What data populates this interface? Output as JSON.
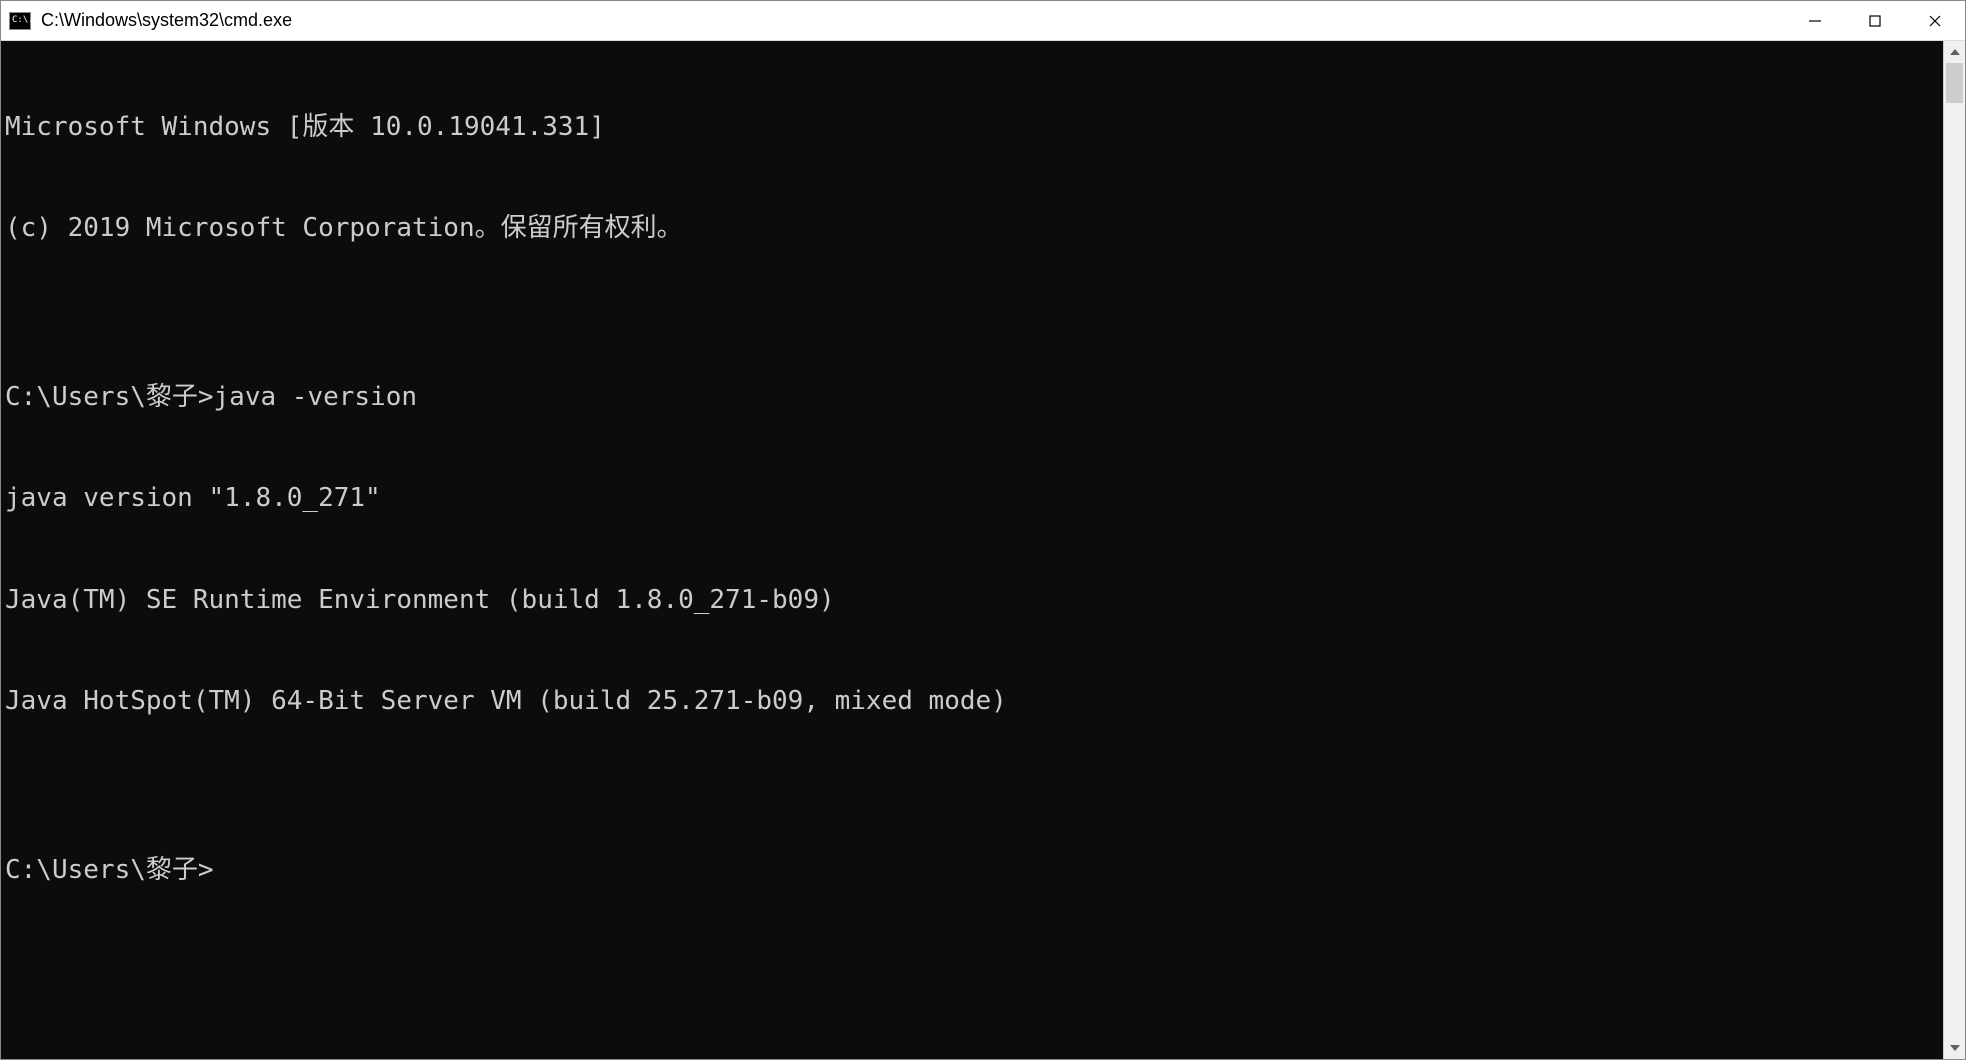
{
  "titlebar": {
    "icon_label": "C:\\.",
    "title": "C:\\Windows\\system32\\cmd.exe"
  },
  "terminal": {
    "lines": [
      "Microsoft Windows [版本 10.0.19041.331]",
      "(c) 2019 Microsoft Corporation。保留所有权利。",
      "",
      "C:\\Users\\黎子>java -version",
      "java version \"1.8.0_271\"",
      "Java(TM) SE Runtime Environment (build 1.8.0_271-b09)",
      "Java HotSpot(TM) 64-Bit Server VM (build 25.271-b09, mixed mode)",
      "",
      "C:\\Users\\黎子>"
    ]
  }
}
